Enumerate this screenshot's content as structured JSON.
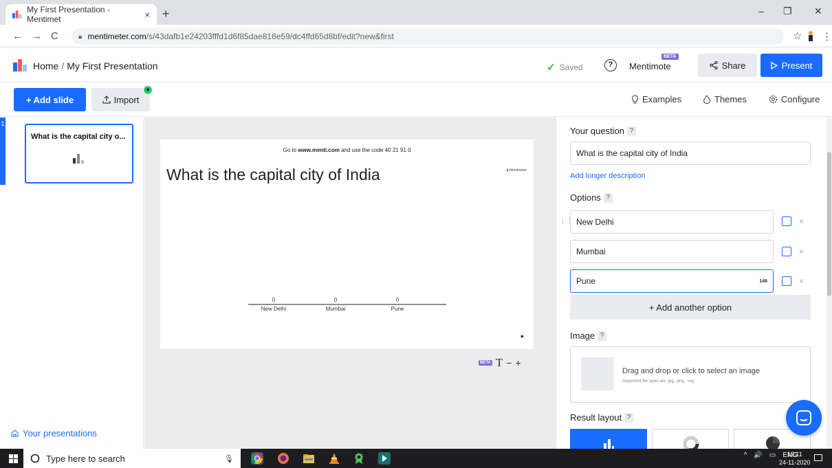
{
  "browser": {
    "tab_title": "My First Presentation - Mentimet",
    "tab_close": "×",
    "new_tab": "+",
    "win_min": "–",
    "win_max": "❐",
    "win_close": "✕",
    "back": "←",
    "forward": "→",
    "reload": "C",
    "url_domain": "mentimeter.com",
    "url_path": "/s/43dafb1e24203fffd1d6f85dae816e59/dc4ffd65d8bf/edit?new&first",
    "star": "☆",
    "menu": "⋮"
  },
  "header": {
    "home": "Home",
    "separator": "/",
    "presentation_title": "My First Presentation",
    "saved": "Saved",
    "help": "?",
    "mentimote": "Mentimote",
    "beta": "BETA",
    "share": "Share",
    "present": "Present"
  },
  "toolbar": {
    "add_slide": "+ Add slide",
    "import": "Import",
    "examples": "Examples",
    "themes": "Themes",
    "configure": "Configure"
  },
  "sidebar": {
    "slide_number": "1",
    "slide_title": "What is the capital city o...",
    "your_presentations": "Your presentations"
  },
  "slide": {
    "code_prefix": "Go to ",
    "code_site": "www.menti.com",
    "code_middle": " and use the code ",
    "code": "40 21 91 0",
    "title": "What is the capital city of India",
    "brand": "Mentimeter",
    "zoom_beta": "BETA",
    "zoom_text": "T",
    "zoom_minus": "−",
    "zoom_plus": "+"
  },
  "chart_data": {
    "type": "bar",
    "categories": [
      "New Delhi",
      "Mumbai",
      "Pune"
    ],
    "values": [
      0,
      0,
      0
    ]
  },
  "panel": {
    "question_label": "Your question",
    "q_mark": "?",
    "question_value": "What is the capital city of India",
    "add_description": "Add longer description",
    "options_label": "Options",
    "options": [
      {
        "value": "New Delhi"
      },
      {
        "value": "Mumbai"
      },
      {
        "value": "Pune",
        "char_count": "146"
      }
    ],
    "remove": "×",
    "add_option": "+ Add another option",
    "image_label": "Image",
    "drop_text": "Drag and drop or click to select an image",
    "drop_subtext": "Supported file types are .jpg, .png, .svg",
    "result_layout_label": "Result layout"
  },
  "taskbar": {
    "search_placeholder": "Type here to search",
    "tray_caret": "^",
    "volume": "🔊",
    "language": "ENG",
    "time": "19:11",
    "date": "24-11-2020"
  },
  "colors": {
    "accent": "#196cff",
    "saved_green": "#4caf50",
    "beta_purple": "#7a6bd8"
  }
}
